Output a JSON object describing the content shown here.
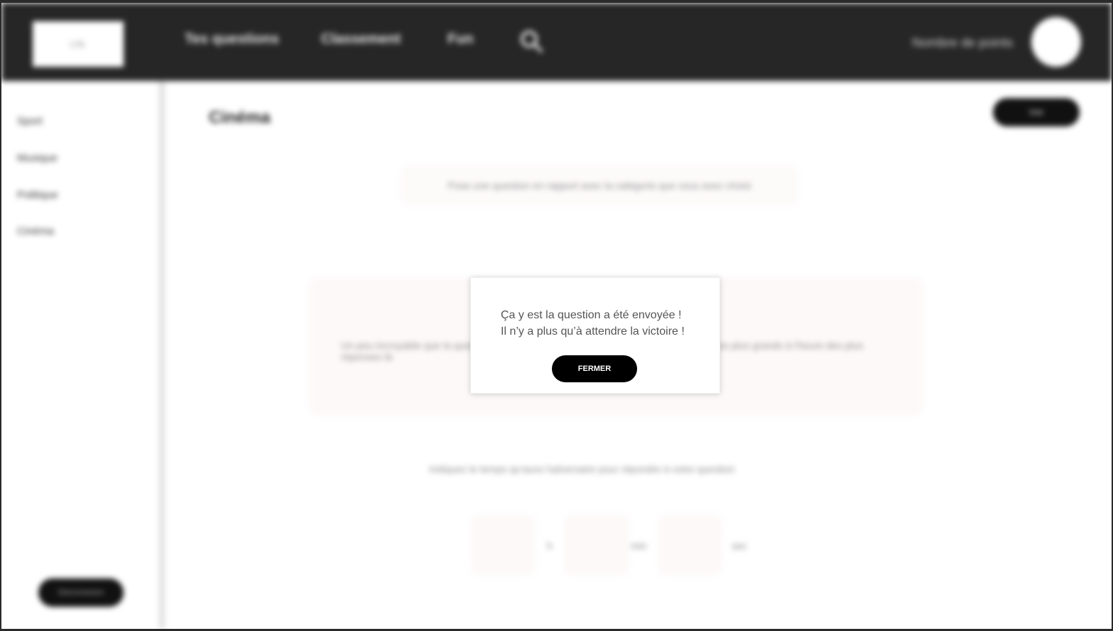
{
  "header": {
    "logo": "LOL",
    "nav": [
      "Tes questions",
      "Classement",
      "Fun"
    ],
    "search_icon": "search-icon",
    "user_label": "Nombre de points"
  },
  "sidebar": {
    "items": [
      "Sport",
      "Musique",
      "Politique",
      "Cinéma"
    ],
    "bottom_button": "Déconnexion"
  },
  "main": {
    "title": "Cinéma",
    "top_button": "Voir",
    "hint": "Pose une question en rapport avec la catégorie que vous avez choisi",
    "card_text": "Un peu incroyable que la question soit comme ça mais c'est en vrai comme celle de nos plus grands à l'heure des plus réponses là",
    "bottom_hint": "Indiquez le temps qu'aura l'adversaire pour répondre à votre question",
    "time_labels": [
      "h",
      "min",
      "sec"
    ]
  },
  "modal": {
    "line1": "Ça y est la question a été envoyée !",
    "line2": "Il n’y a plus qu’à attendre la victoire !",
    "close_label": "FERMER"
  }
}
